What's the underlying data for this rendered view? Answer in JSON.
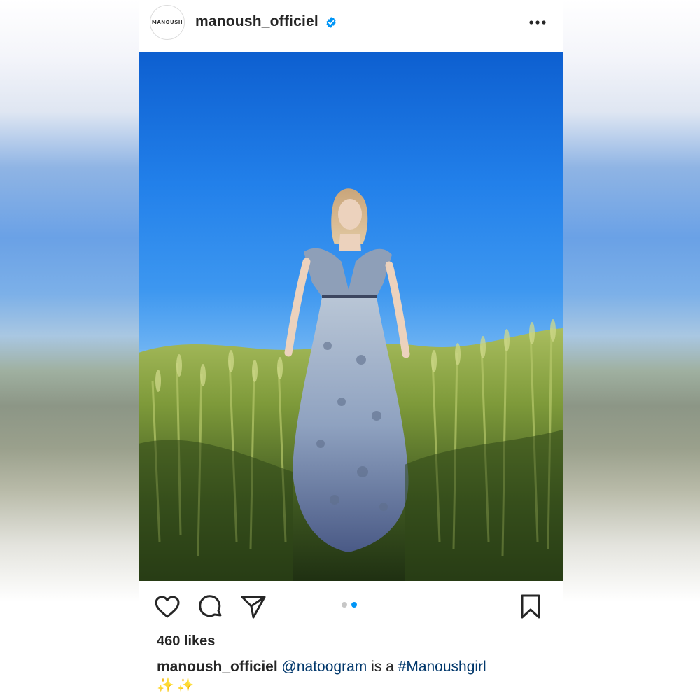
{
  "post": {
    "avatar_text": "MANOUSH",
    "username": "manoush_officiel",
    "verified": true,
    "more_icon": "more-horizontal-icon"
  },
  "photo": {
    "colors": {
      "sky_top": "#0d5fd0",
      "sky_bottom": "#6cb2f2",
      "wheat": "#7f9a3c",
      "dress": "#8fa8c8"
    }
  },
  "carousel": {
    "count": 2,
    "active_index": 1
  },
  "actions": {
    "like_icon": "heart-icon",
    "comment_icon": "comment-icon",
    "share_icon": "send-icon",
    "save_icon": "bookmark-icon"
  },
  "likes": "460 likes",
  "caption": {
    "username": "manoush_officiel",
    "mention": "@natoogram",
    "text": "is a",
    "hashtag": "#Manoushgirl",
    "emoji": "✨✨"
  },
  "colors": {
    "accent": "#0095f6",
    "verified": "#0095f6",
    "text": "#262626",
    "link": "#00376b"
  }
}
